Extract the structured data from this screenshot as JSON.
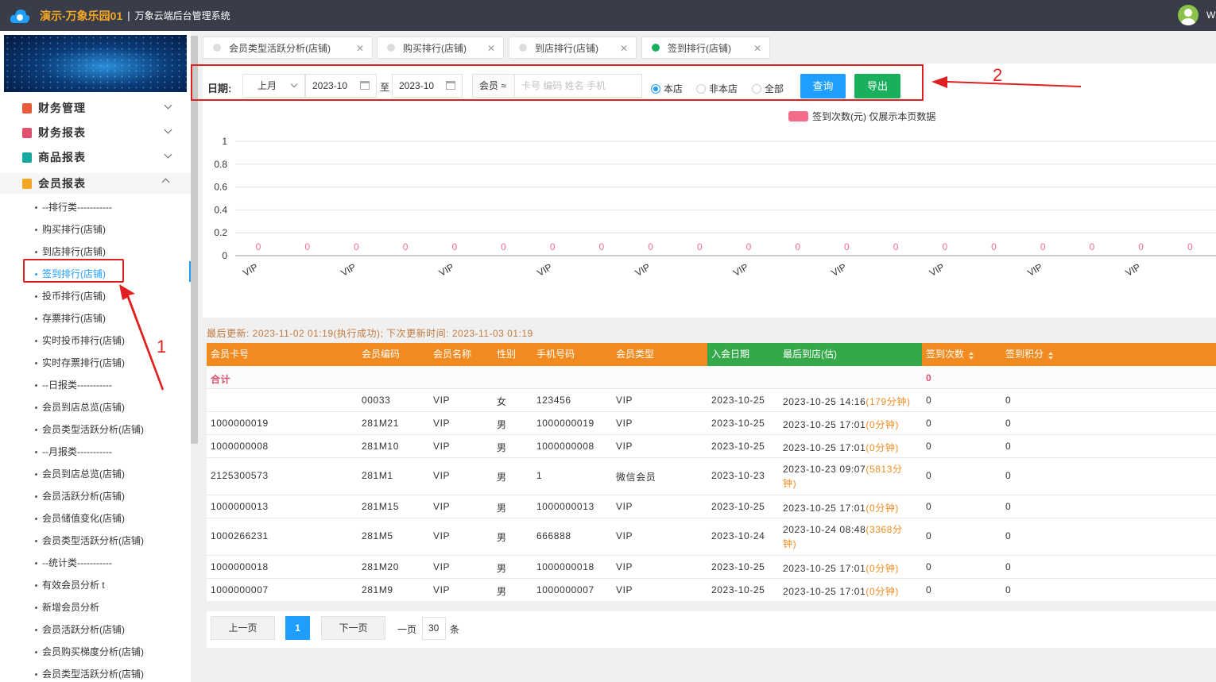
{
  "app": {
    "title": "演示-万象乐园01",
    "separator": "|",
    "subtitle": "万象云端后台管理系统",
    "user_initial": "W"
  },
  "sidebar": {
    "groups": [
      {
        "label": "财务管理",
        "color": "#e85b3a"
      },
      {
        "label": "财务报表",
        "color": "#e0506d"
      },
      {
        "label": "商品报表",
        "color": "#17a8a0"
      },
      {
        "label": "会员报表",
        "color": "#f5a623"
      }
    ],
    "items": [
      "--排行类-----------",
      "购买排行(店铺)",
      "到店排行(店铺)",
      "签到排行(店铺)",
      "投币排行(店铺)",
      "存票排行(店铺)",
      "实时投币排行(店铺)",
      "实时存票排行(店铺)",
      "--日报类-----------",
      "会员到店总览(店铺)",
      "会员类型活跃分析(店铺)",
      "--月报类-----------",
      "会员到店总览(店铺)",
      "会员活跃分析(店铺)",
      "会员储值变化(店铺)",
      "会员类型活跃分析(店铺)",
      "--统计类-----------",
      "有效会员分析 t",
      "新增会员分析",
      "会员活跃分析(店铺)",
      "会员购买梯度分析(店铺)",
      "会员类型活跃分析(店铺)"
    ]
  },
  "tabs": [
    "会员类型活跃分析(店铺)",
    "购买排行(店铺)",
    "到店排行(店铺)",
    "签到排行(店铺)"
  ],
  "filter": {
    "label": "日期:",
    "period": "上月",
    "from": "2023-10",
    "to_sep": "至",
    "to": "2023-10",
    "member_type": "会员 ≈",
    "search_placeholder": "卡号 编码 姓名 手机",
    "radios": [
      "本店",
      "非本店",
      "全部"
    ],
    "query": "查询",
    "export": "导出",
    "query_color": "#1e9fff",
    "export_color": "#1aaf5d"
  },
  "annotations": {
    "one": "1",
    "two": "2"
  },
  "chart_data": {
    "type": "bar",
    "legend": "签到次数(元) 仅展示本页数据",
    "series": [
      {
        "name": "签到次数(元)",
        "values": [
          0,
          0,
          0,
          0,
          0,
          0,
          0,
          0,
          0,
          0,
          0,
          0,
          0,
          0,
          0,
          0,
          0,
          0,
          0,
          0
        ]
      }
    ],
    "categories": [
      "VIP",
      "VIP",
      "VIP",
      "VIP",
      "VIP",
      "VIP",
      "VIP",
      "VIP",
      "VIP",
      "VIP",
      "VIP",
      "VIP",
      "VIP",
      "VIP",
      "VIP",
      "VIP",
      "VIP",
      "VIP",
      "VIP",
      "VIP"
    ],
    "x_tick_labels": [
      "VIP",
      "VIP",
      "VIP",
      "VIP",
      "VIP",
      "VIP",
      "VIP",
      "VIP",
      "VIP",
      "VIP"
    ],
    "yticks": [
      "1",
      "0.8",
      "0.6",
      "0.4",
      "0.2",
      "0"
    ],
    "ylim": [
      0,
      1
    ],
    "bar_color": "#f36d8b",
    "grid": true
  },
  "update_text": "最后更新: 2023-11-02 01:19(执行成功); 下次更新时间: 2023-11-03 01:19",
  "table": {
    "headers": [
      "会员卡号",
      "会员编码",
      "会员名称",
      "性别",
      "手机号码",
      "会员类型",
      "入会日期",
      "最后到店(估)",
      "签到次数",
      "签到积分"
    ],
    "sum_label": "合计",
    "sum_value": "0",
    "rows": [
      {
        "card": "",
        "code": "00033",
        "name": "VIP",
        "sex": "女",
        "phone": "123456",
        "type": "VIP",
        "join": "2023-10-25",
        "last": "2023-10-25 14:16",
        "mins": "(179分钟)",
        "count": "0",
        "points": "0"
      },
      {
        "card": "1000000019",
        "code": "281M21",
        "name": "VIP",
        "sex": "男",
        "phone": "1000000019",
        "type": "VIP",
        "join": "2023-10-25",
        "last": "2023-10-25 17:01",
        "mins": "(0分钟)",
        "count": "0",
        "points": "0"
      },
      {
        "card": "1000000008",
        "code": "281M10",
        "name": "VIP",
        "sex": "男",
        "phone": "1000000008",
        "type": "VIP",
        "join": "2023-10-25",
        "last": "2023-10-25 17:01",
        "mins": "(0分钟)",
        "count": "0",
        "points": "0"
      },
      {
        "card": "2125300573",
        "code": "281M1",
        "name": "VIP",
        "sex": "男",
        "phone": "1",
        "type": "微信会员",
        "join": "2023-10-23",
        "last": "2023-10-23 09:07",
        "mins": "(5813分",
        "mins2": "钟)",
        "count": "0",
        "points": "0"
      },
      {
        "card": "1000000013",
        "code": "281M15",
        "name": "VIP",
        "sex": "男",
        "phone": "1000000013",
        "type": "VIP",
        "join": "2023-10-25",
        "last": "2023-10-25 17:01",
        "mins": "(0分钟)",
        "count": "0",
        "points": "0"
      },
      {
        "card": "1000266231",
        "code": "281M5",
        "name": "VIP",
        "sex": "男",
        "phone": "666888",
        "type": "VIP",
        "join": "2023-10-24",
        "last": "2023-10-24 08:48",
        "mins": "(3368分",
        "mins2": "钟)",
        "count": "0",
        "points": "0"
      },
      {
        "card": "1000000018",
        "code": "281M20",
        "name": "VIP",
        "sex": "男",
        "phone": "1000000018",
        "type": "VIP",
        "join": "2023-10-25",
        "last": "2023-10-25 17:01",
        "mins": "(0分钟)",
        "count": "0",
        "points": "0"
      },
      {
        "card": "1000000007",
        "code": "281M9",
        "name": "VIP",
        "sex": "男",
        "phone": "1000000007",
        "type": "VIP",
        "join": "2023-10-25",
        "last": "2023-10-25 17:01",
        "mins": "(0分钟)",
        "count": "0",
        "points": "0"
      }
    ]
  },
  "pager": {
    "prev": "上一页",
    "page": "1",
    "next": "下一页",
    "per_label": "一页",
    "per_value": "30",
    "unit": "条"
  }
}
